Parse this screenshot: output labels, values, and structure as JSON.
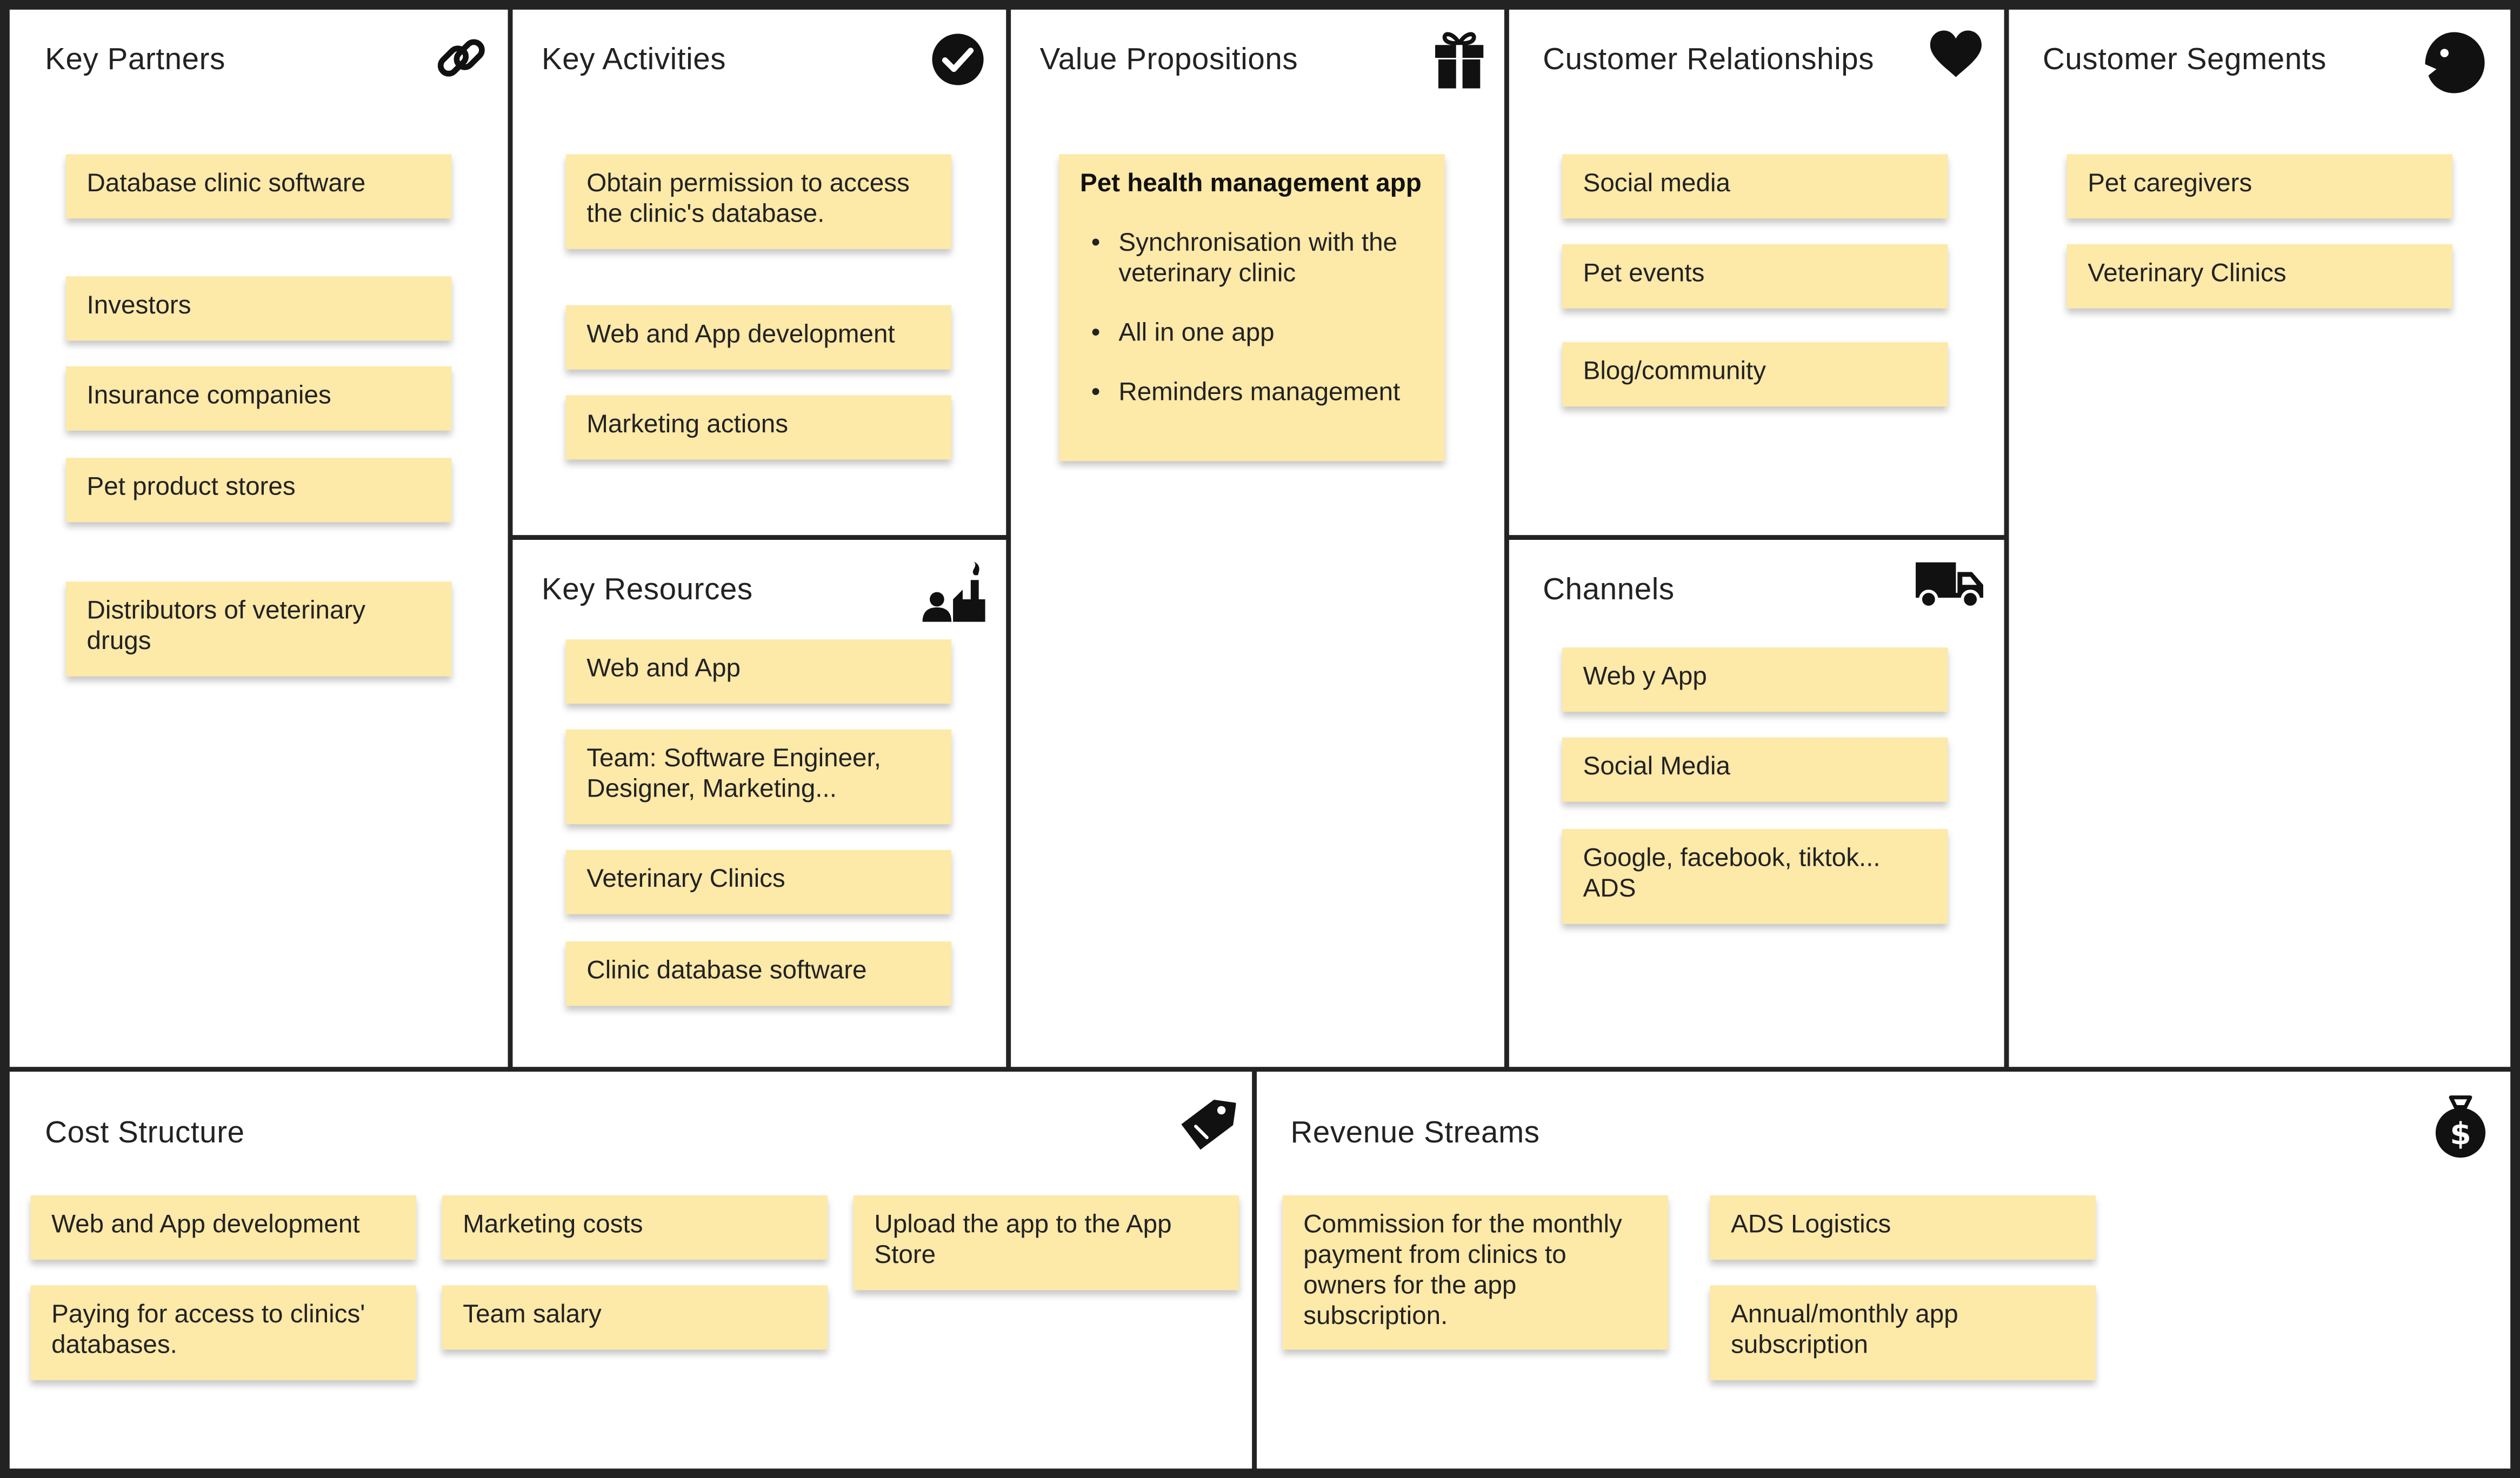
{
  "canvas": {
    "blocks": {
      "key_partners": {
        "title": "Key Partners",
        "icon": "link-icon",
        "notes": [
          "Database clinic software",
          "Investors",
          "Insurance companies",
          "Pet product stores",
          "Distributors of veterinary drugs"
        ]
      },
      "key_activities": {
        "title": "Key Activities",
        "icon": "checkmark-icon",
        "notes": [
          "Obtain permission to access the clinic's database.",
          "Web and App development",
          "Marketing actions"
        ]
      },
      "key_resources": {
        "title": "Key Resources",
        "icon": "factory-icon",
        "notes": [
          "Web and App",
          "Team: Software Engineer, Designer, Marketing...",
          "Veterinary Clinics",
          "Clinic database software"
        ]
      },
      "value_propositions": {
        "title": "Value Propositions",
        "icon": "gift-icon",
        "note": {
          "heading": "Pet health management app",
          "bullets": [
            "Synchronisation with the veterinary clinic",
            "All in one app",
            "Reminders management"
          ]
        }
      },
      "customer_relationships": {
        "title": "Customer Relationships",
        "icon": "heart-icon",
        "notes": [
          "Social media",
          "Pet events",
          "Blog/community"
        ]
      },
      "channels": {
        "title": "Channels",
        "icon": "truck-icon",
        "notes": [
          "Web y App",
          "Social Media",
          "Google, facebook, tiktok... ADS"
        ]
      },
      "customer_segments": {
        "title": "Customer Segments",
        "icon": "face-icon",
        "notes": [
          "Pet caregivers",
          "Veterinary Clinics"
        ]
      },
      "cost_structure": {
        "title": "Cost Structure",
        "icon": "price-tag-icon",
        "notes": [
          "Web and App development",
          "Paying for access to clinics' databases.",
          "Marketing costs",
          "Team salary",
          "Upload the app to the App Store"
        ]
      },
      "revenue_streams": {
        "title": "Revenue Streams",
        "icon": "money-bag-icon",
        "notes": [
          "Commission for the monthly payment from clinics to owners for the app subscription.",
          "ADS Logistics",
          "Annual/monthly app subscription"
        ]
      }
    }
  }
}
